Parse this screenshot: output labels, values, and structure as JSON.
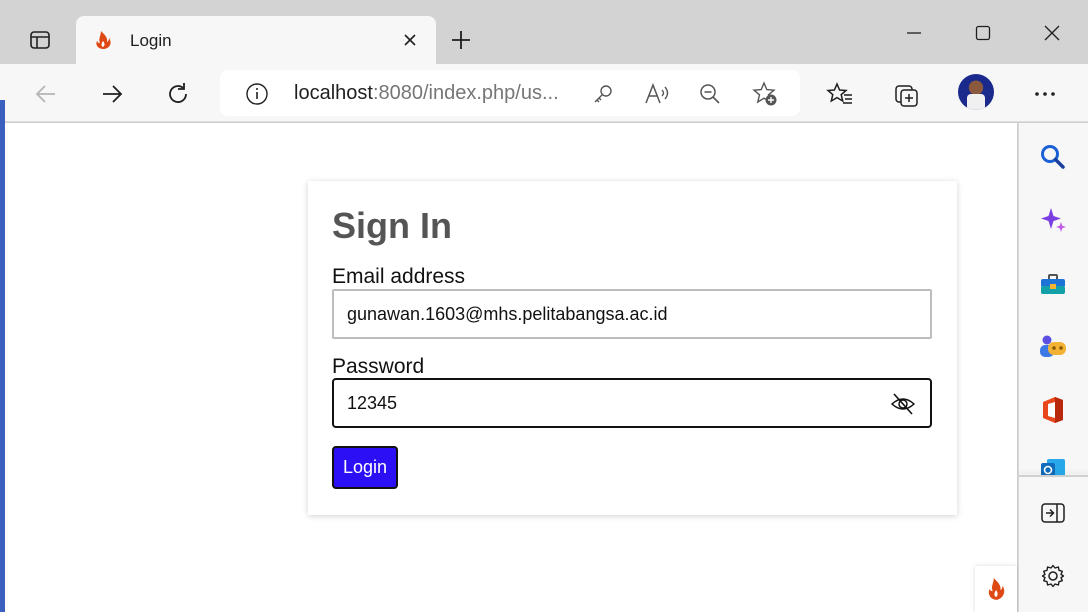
{
  "tab": {
    "title": "Login"
  },
  "address": {
    "host": "localhost",
    "rest": ":8080/index.php/us..."
  },
  "form": {
    "heading": "Sign In",
    "email_label": "Email address",
    "email_value": "gunawan.1603@mhs.pelitabangsa.ac.id",
    "password_label": "Password",
    "password_value": "12345",
    "submit_label": "Login"
  },
  "colors": {
    "login_button": "#2b0ff5",
    "heading": "#555555",
    "favicon": "#dd4814"
  },
  "icons": {
    "sidebar": [
      "search-icon",
      "copilot-icon",
      "tools-icon",
      "games-icon",
      "office-icon",
      "outlook-icon",
      "open-pane-icon",
      "settings-icon"
    ]
  }
}
